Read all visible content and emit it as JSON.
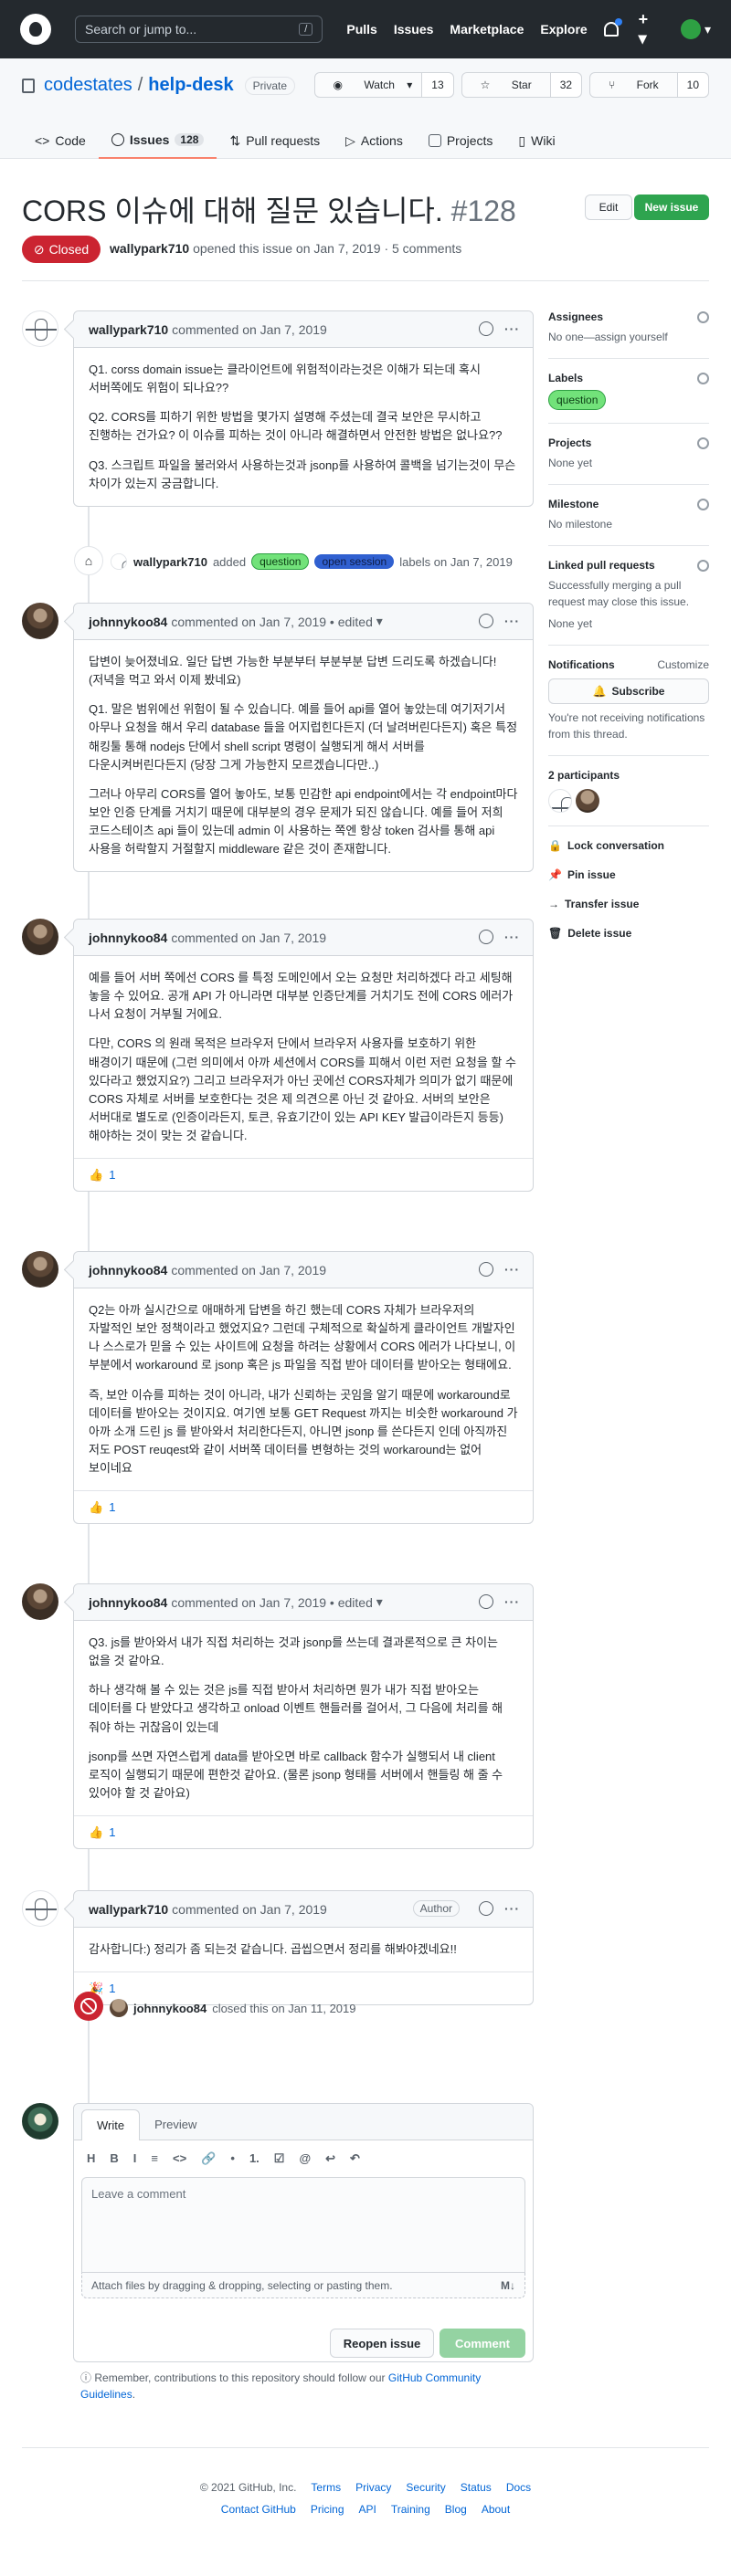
{
  "header": {
    "search_placeholder": "Search or jump to...",
    "slash": "/",
    "nav": [
      "Pulls",
      "Issues",
      "Marketplace",
      "Explore"
    ]
  },
  "repo": {
    "owner": "codestates",
    "sep": "/",
    "name": "help-desk",
    "visibility": "Private",
    "watch": {
      "label": "Watch",
      "count": "13"
    },
    "star": {
      "label": "Star",
      "count": "32"
    },
    "fork": {
      "label": "Fork",
      "count": "10"
    },
    "tabs": [
      {
        "label": "Code"
      },
      {
        "label": "Issues",
        "count": "128"
      },
      {
        "label": "Pull requests"
      },
      {
        "label": "Actions"
      },
      {
        "label": "Projects"
      },
      {
        "label": "Wiki"
      }
    ]
  },
  "issue": {
    "title": "CORS 이슈에 대해 질문 있습니다.",
    "number": "#128",
    "state": "Closed",
    "author": "wallypark710",
    "meta": "opened this issue on Jan 7, 2019 · 5 comments",
    "edit": "Edit",
    "new_issue": "New issue"
  },
  "comments": [
    {
      "author": "wallypark710",
      "when": "commented on Jan 7, 2019",
      "paras": [
        "Q1. corss domain issue는 클라이언트에 위험적이라는것은 이해가 되는데 혹시 서버쪽에도 위험이 되나요??",
        "Q2. CORS를 피하기 위한 방법을 몇가지 설명해 주셨는데 결국 보안은 무시하고 진행하는 건가요? 이 이슈를 피하는 것이 아니라 해결하면서 안전한 방법은 없나요??",
        "Q3. 스크립트 파일을 불러와서 사용하는것과 jsonp를 사용하여 콜백을 넘기는것이 무슨 차이가 있는지 궁금합니다."
      ]
    },
    {
      "author": "johnnykoo84",
      "when": "commented on Jan 7, 2019 • edited",
      "paras": [
        "답변이 늦어졌네요. 일단 답변 가능한 부분부터 부분부분 답변 드리도록 하겠습니다! (저녁을 먹고 와서 이제 봤네요)",
        "Q1. 말은 범위에선 위험이 될 수 있습니다. 예를 들어 api를 열어 놓았는데 여기저기서 아무나 요청을 해서 우리 database 들을 어지럽힌다든지 (더 날려버린다든지) 혹은 특정 해킹툴 통해 nodejs 단에서 shell script 명령이 실행되게 해서 서버를 다운시켜버린다든지 (당장 그게 가능한지 모르겠습니다만..)",
        "그러나 아무리 CORS를 열어 놓아도, 보통 민감한 api endpoint에서는 각 endpoint마다 보안 인증 단계를 거치기 때문에 대부분의 경우 문제가 되진 않습니다. 예를 들어 저희 코드스테이츠 api 들이 있는데 admin 이 사용하는 쪽엔 항상 token 검사를 통해 api 사용을 허락할지 거절할지 middleware 같은 것이 존재합니다."
      ]
    },
    {
      "author": "johnnykoo84",
      "when": "commented on Jan 7, 2019",
      "paras": [
        "예를 들어 서버 쪽에선 CORS 를 특정 도메인에서 오는 요청만 처리하겠다 라고 세팅해 놓을 수 있어요. 공개 API 가 아니라면 대부분 인증단계를 거치기도 전에 CORS 에러가 나서 요청이 거부될 거에요.",
        "다만, CORS 의 원래 목적은 브라우저 단에서 브라우저 사용자를 보호하기 위한 배경이기 때문에 (그런 의미에서 아까 세션에서 CORS를 피해서 이런 저런 요청을 할 수 있다라고 했었지요?) 그리고 브라우저가 아닌 곳에선 CORS자체가 의미가 없기 때문에 CORS 자체로 서버를 보호한다는 것은 제 의견으론 아닌 것 같아요. 서버의 보안은 서버대로 별도로 (인증이라든지, 토큰, 유효기간이 있는 API KEY 발급이라든지 등등) 해야하는 것이 맞는 것 같습니다."
      ],
      "reaction": "👍",
      "reaction_count": "1"
    },
    {
      "author": "johnnykoo84",
      "when": "commented on Jan 7, 2019",
      "paras": [
        "Q2는 아까 실시간으로 애매하게 답변을 하긴 했는데 CORS 자체가 브라우저의 자발적인 보안 정책이라고 했었지요? 그런데 구체적으로 확실하게 클라이언트 개발자인 나 스스로가 믿을 수 있는 사이트에 요청을 하려는 상황에서 CORS 에러가 나다보니, 이 부분에서 workaround 로 jsonp 혹은 js 파일을 직접 받아 데이터를 받아오는 형태에요.",
        "즉, 보안 이슈를 피하는 것이 아니라, 내가 신뢰하는 곳임을 알기 때문에 workaround로 데이터를 받아오는 것이지요. 여기엔 보통 GET Request 까지는 비슷한 workaround 가 아까 소개 드린 js 를 받아와서 처리한다든지, 아니면 jsonp 를 쓴다든지 인데 아직까진 저도 POST reuqest와 같이 서버쪽 데이터를 변형하는 것의 workaround는 없어 보이네요"
      ],
      "reaction": "👍",
      "reaction_count": "1"
    },
    {
      "author": "johnnykoo84",
      "when": "commented on Jan 7, 2019 • edited",
      "paras": [
        "Q3. js를 받아와서 내가 직접 처리하는 것과 jsonp를 쓰는데 결과론적으로 큰 차이는 없을 것 같아요.",
        "하나 생각해 볼 수 있는 것은 js를 직접 받아서 처리하면 뭔가 내가 직접 받아오는 데이터를 다 받았다고 생각하고 onload 이벤트 핸들러를 걸어서, 그 다음에 처리를 해 줘야 하는 귀찮음이 있는데",
        "jsonp를 쓰면 자연스럽게 data를 받아오면 바로 callback 함수가 실행되서 내 client 로직이 실행되기 때문에 편한것 같아요. (물론 jsonp 형태를 서버에서 핸들링 해 줄 수 있어야 할 것 같아요)"
      ],
      "reaction": "👍",
      "reaction_count": "1"
    },
    {
      "author": "wallypark710",
      "when": "commented on Jan 7, 2019",
      "author_badge": "Author",
      "paras": [
        "감사합니다:) 정리가 좀 되는것 같습니다. 곱씹으면서 정리를 해봐야겠네요!!"
      ],
      "reaction": "🎉",
      "reaction_count": "1"
    }
  ],
  "label_event": {
    "actor": "wallypark710",
    "action": "added",
    "labels": [
      "question",
      "open session"
    ],
    "suffix": "labels on Jan 7, 2019"
  },
  "close_event": {
    "actor": "johnnykoo84",
    "text": "closed this on Jan 11, 2019"
  },
  "sidebar": {
    "assignees": {
      "title": "Assignees",
      "value": "No one—assign yourself"
    },
    "labels": {
      "title": "Labels",
      "value": "question"
    },
    "projects": {
      "title": "Projects",
      "value": "None yet"
    },
    "milestone": {
      "title": "Milestone",
      "value": "No milestone"
    },
    "linked": {
      "title": "Linked pull requests",
      "desc": "Successfully merging a pull request may close this issue.",
      "value": "None yet"
    },
    "notifications": {
      "title": "Notifications",
      "customize": "Customize",
      "button": "Subscribe",
      "desc": "You're not receiving notifications from this thread."
    },
    "participants": {
      "title": "2 participants"
    },
    "actions": [
      "Lock conversation",
      "Pin issue",
      "Transfer issue",
      "Delete issue"
    ]
  },
  "composer": {
    "tabs": [
      "Write",
      "Preview"
    ],
    "toolbar": [
      "H",
      "B",
      "I",
      "≡",
      "<>",
      "🔗",
      "•",
      "1.",
      "☑",
      "@",
      "↩",
      "↶"
    ],
    "placeholder": "Leave a comment",
    "attach": "Attach files by dragging & dropping, selecting or pasting them.",
    "reopen": "Reopen issue",
    "comment": "Comment"
  },
  "reminder": {
    "text": "Remember, contributions to this repository should follow our",
    "link": "GitHub Community Guidelines",
    "end": "."
  },
  "footer": {
    "copyright": "© 2021 GitHub, Inc.",
    "links1": [
      "Terms",
      "Privacy",
      "Security",
      "Status",
      "Docs"
    ],
    "links2": [
      "Contact GitHub",
      "Pricing",
      "API",
      "Training",
      "Blog",
      "About"
    ]
  }
}
